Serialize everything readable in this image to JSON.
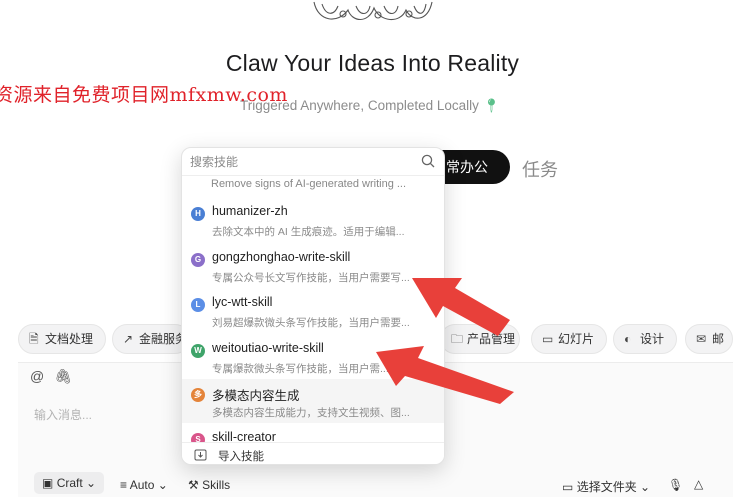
{
  "hero": {
    "title": "Claw Your Ideas Into Reality",
    "subtitle": "Triggered Anywhere, Completed Locally"
  },
  "watermark": "资源来自免费项目网mfxmw.com",
  "category_toggle": {
    "active": "常办公",
    "inactive": "任务"
  },
  "skill_popup": {
    "search_placeholder": "搜索技能",
    "truncated_description": "Remove signs of AI-generated writing ...",
    "skills": [
      {
        "initial": "H",
        "name": "humanizer-zh",
        "description": "去除文本中的 AI 生成痕迹。适用于编辑...",
        "avatar_color": "#4a7fd4"
      },
      {
        "initial": "G",
        "name": "gongzhonghao-write-skill",
        "description": "专属公众号长文写作技能，当用户需要写...",
        "avatar_color": "#8b6fc9"
      },
      {
        "initial": "L",
        "name": "lyc-wtt-skill",
        "description": "刘易超爆款微头条写作技能，当用户需要...",
        "avatar_color": "#5b8ee6"
      },
      {
        "initial": "W",
        "name": "weitoutiao-write-skill",
        "description": "专属爆款微头条写作技能，当用户需...",
        "avatar_color": "#3fa46a"
      },
      {
        "initial": "多",
        "name": "多模态内容生成",
        "description": "多模态内容生成能力，支持文生视频、图...",
        "avatar_color": "#e4843a"
      },
      {
        "initial": "S",
        "name": "skill-creator",
        "description": "",
        "avatar_color": "#d9558a"
      }
    ],
    "import_label": "导入技能"
  },
  "chips": [
    {
      "label": "文档处理",
      "icon": "document-icon"
    },
    {
      "label": "金融服务",
      "icon": "chart-icon"
    },
    {
      "label": "产品管理",
      "icon": "folder-icon"
    },
    {
      "label": "幻灯片",
      "icon": "slides-icon"
    },
    {
      "label": "设计",
      "icon": "palette-icon"
    },
    {
      "label": "邮",
      "icon": "mail-icon"
    }
  ],
  "composer": {
    "placeholder": "输入消息...",
    "mode": "Craft",
    "model": "Auto",
    "skills_label": "Skills",
    "folder_label": "选择文件夹"
  },
  "colors": {
    "accent_dark": "#111111",
    "arrow": "#e8403a"
  }
}
